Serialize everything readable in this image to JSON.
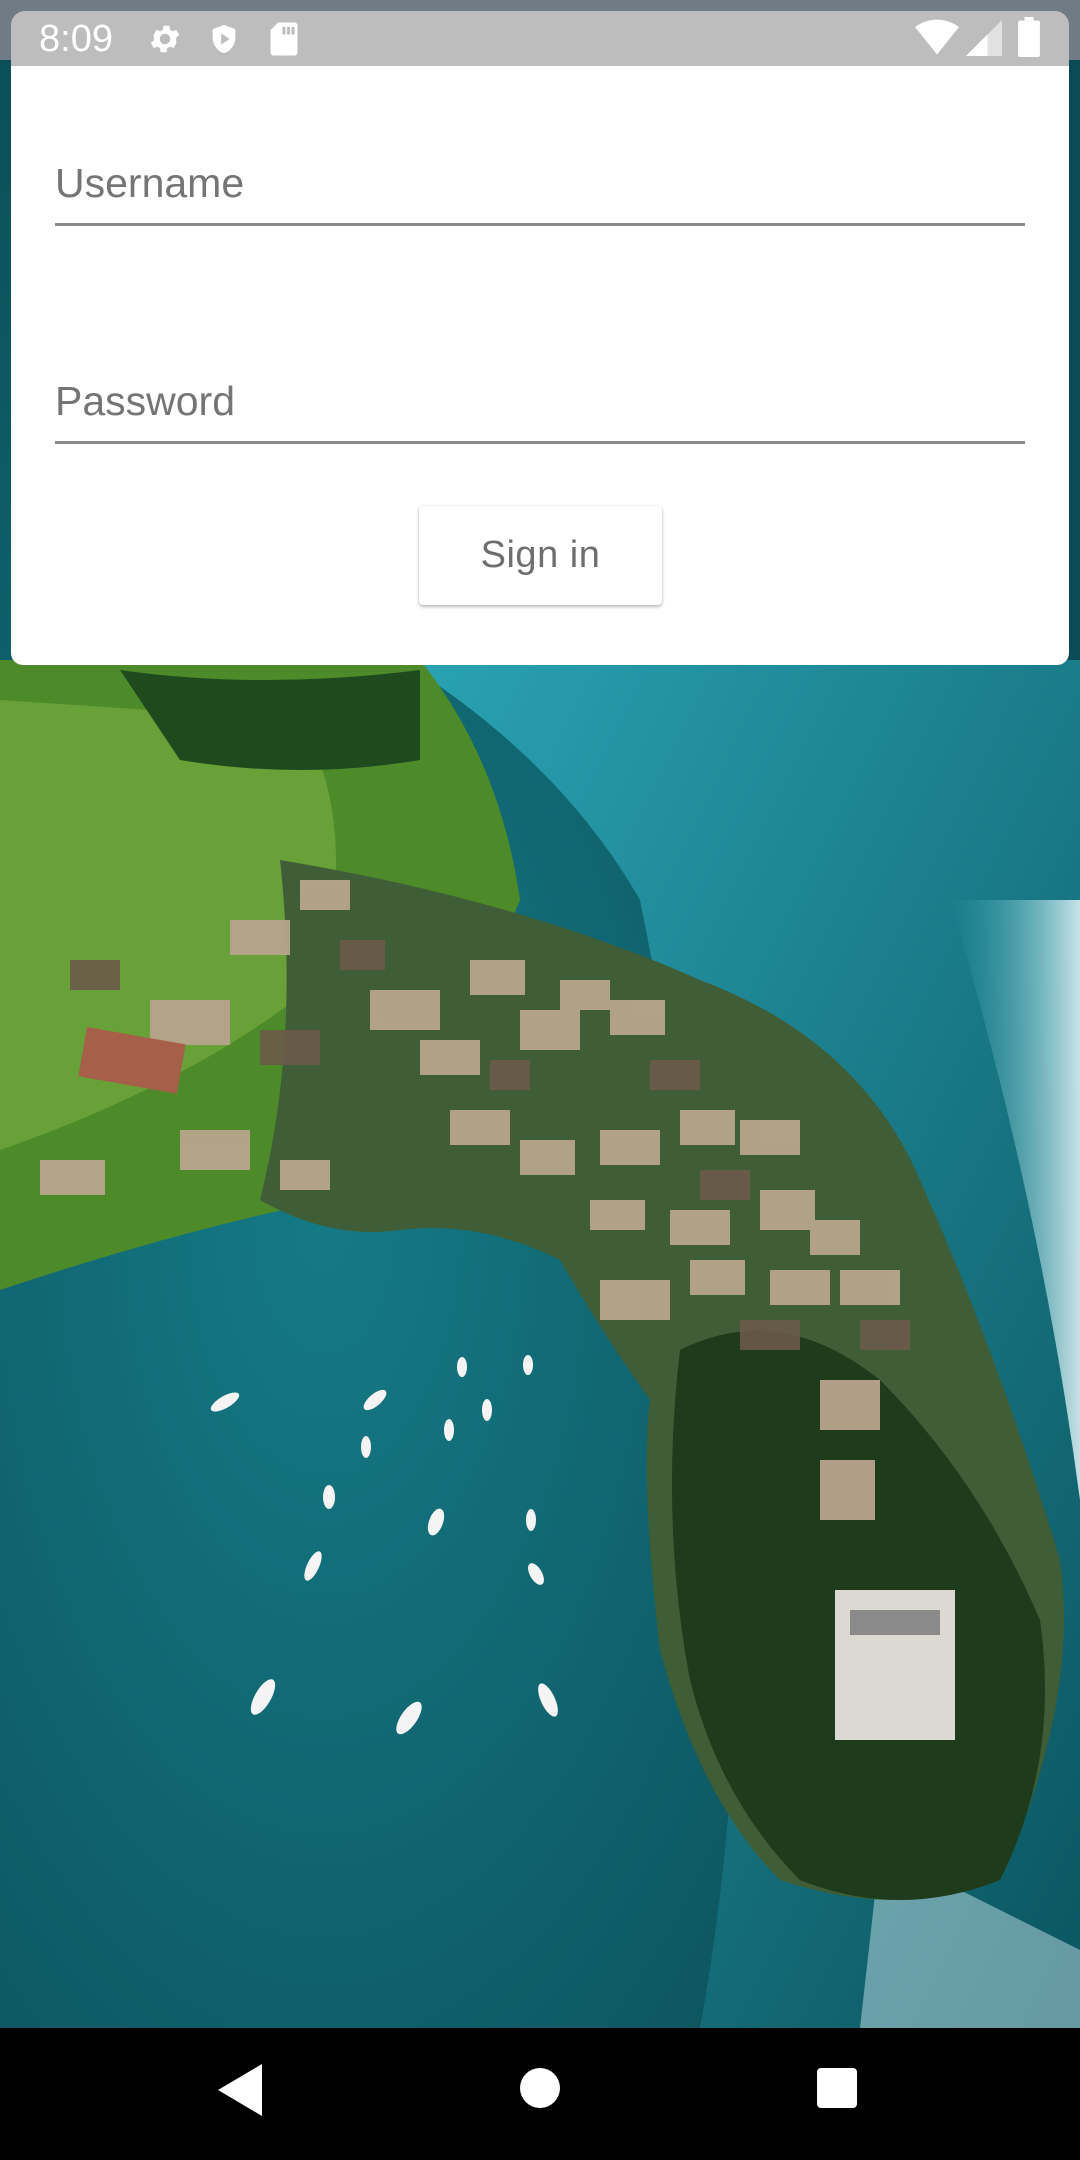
{
  "status_bar": {
    "time": "8:09",
    "left_icons": [
      "gear-icon",
      "shield-icon",
      "sd-card-icon"
    ],
    "right_icons": [
      "wifi-icon",
      "cell-signal-icon",
      "battery-icon"
    ]
  },
  "login_form": {
    "username_label": "Username",
    "username_value": "",
    "password_label": "Password",
    "password_value": "",
    "sign_in_label": "Sign in"
  },
  "background": {
    "description_icon": "aerial-lake-village-image"
  },
  "nav_bar": {
    "buttons": [
      "back-icon",
      "home-icon",
      "recents-icon"
    ]
  },
  "colors": {
    "status_bar": "#bdbdbd",
    "card": "#ffffff",
    "label": "#757575",
    "underline": "#8a8a8a",
    "button_text": "#6e6e6e",
    "water": "#0f6a73",
    "nav_bar": "#000000"
  }
}
